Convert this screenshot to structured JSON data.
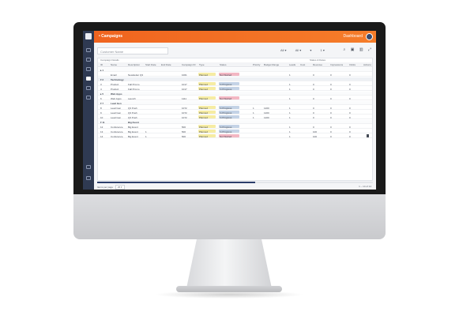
{
  "topbar": {
    "title": "• Campaigns",
    "right_label": "Dashboard"
  },
  "search": {
    "placeholder": "Customer Name"
  },
  "filters": [
    {
      "label": "All ▾"
    },
    {
      "label": "All ▾"
    },
    {
      "label": "▾"
    },
    {
      "label": "1 ▾"
    }
  ],
  "group_labels": {
    "left": "Campaign Details",
    "right": "Status & Dates"
  },
  "columns": [
    "ID",
    "Name",
    "Description",
    "Start Date",
    "End Date",
    "Campaign ID",
    "Type",
    "Status",
    "Priority",
    "Budget Range",
    "Leads",
    "Cost",
    "Revenue",
    "Impressions",
    "Clicks",
    "Actions"
  ],
  "rows": [
    {
      "kind": "group",
      "cells": [
        "▸ 1",
        "",
        "",
        "",
        "",
        "",
        "",
        "",
        "",
        "",
        "",
        "",
        "",
        "",
        "",
        ""
      ]
    },
    {
      "kind": "data",
      "cells": [
        "",
        "Email",
        "Newsletter Q3",
        "",
        "",
        "1001",
        "Planned",
        "Not Started",
        "",
        "",
        "1",
        "",
        "0",
        "0",
        "0",
        ""
      ],
      "status": "pink"
    },
    {
      "kind": "group",
      "cells": [
        "▾ 2",
        "Technology",
        "",
        "",
        "",
        "",
        "",
        "",
        "",
        "",
        "",
        "",
        "",
        "",
        "",
        ""
      ]
    },
    {
      "kind": "data",
      "cells": [
        "3",
        "Product",
        "Fall Promo",
        "",
        "",
        "1017",
        "Planned",
        "In Progress",
        "",
        "",
        "1",
        "",
        "0",
        "0",
        "0",
        ""
      ],
      "status": "blue"
    },
    {
      "kind": "data",
      "cells": [
        "4",
        "Product",
        "Fall Promo",
        "",
        "",
        "1017",
        "Planned",
        "In Progress",
        "",
        "",
        "1",
        "",
        "0",
        "0",
        "0",
        ""
      ],
      "status": "blue"
    },
    {
      "kind": "group",
      "cells": [
        "▸ 5",
        "Web Apps",
        "",
        "",
        "",
        "",
        "",
        "",
        "",
        "",
        "",
        "",
        "",
        "",
        "",
        ""
      ]
    },
    {
      "kind": "data",
      "cells": [
        "6",
        "Web Apps",
        "Launch",
        "",
        "",
        "1111",
        "Planned",
        "Not Started",
        "",
        "",
        "1",
        "",
        "0",
        "0",
        "0",
        ""
      ],
      "status": "pink"
    },
    {
      "kind": "group",
      "cells": [
        "▾ 7",
        "Lead Gen",
        "",
        "",
        "",
        "",
        "",
        "",
        "",
        "",
        "",
        "",
        "",
        "",
        "",
        ""
      ]
    },
    {
      "kind": "data",
      "cells": [
        "8",
        "Lead Gen",
        "Q3 Push",
        "",
        "",
        "1072",
        "Planned",
        "In Progress",
        "1",
        "1200",
        "1",
        "",
        "0",
        "0",
        "0",
        ""
      ],
      "status": "blue"
    },
    {
      "kind": "data",
      "cells": [
        "9",
        "Lead Gen",
        "Q3 Push",
        "",
        "",
        "1072",
        "Planned",
        "In Progress",
        "1",
        "1200",
        "1",
        "",
        "0",
        "0",
        "0",
        ""
      ],
      "status": "blue"
    },
    {
      "kind": "data",
      "cells": [
        "10",
        "Lead Gen",
        "Q3 Push",
        "",
        "",
        "1072",
        "Planned",
        "In Progress",
        "1",
        "1200",
        "1",
        "",
        "0",
        "0",
        "0",
        ""
      ],
      "status": "blue"
    },
    {
      "kind": "group",
      "cells": [
        "▾ 11",
        "",
        "Big Event",
        "",
        "",
        "",
        "",
        "",
        "",
        "",
        "",
        "",
        "",
        "",
        "",
        ""
      ]
    },
    {
      "kind": "data",
      "cells": [
        "12",
        "Conference",
        "Big Event",
        "",
        "",
        "500",
        "Planned",
        "In Progress",
        "",
        "",
        "1",
        "",
        "0",
        "0",
        "0",
        ""
      ],
      "status": "blue"
    },
    {
      "kind": "data",
      "cells": [
        "13",
        "Conference",
        "Big Event",
        "1",
        "",
        "500",
        "Planned",
        "In Progress",
        "",
        "",
        "1",
        "",
        "100",
        "0",
        "0",
        ""
      ],
      "status": "blue"
    },
    {
      "kind": "data",
      "cells": [
        "14",
        "Conference",
        "Big Event",
        "1",
        "",
        "500",
        "Planned",
        "Not Started",
        "",
        "",
        "1",
        "",
        "100",
        "0",
        "0",
        ""
      ],
      "status": "pink"
    }
  ],
  "pager": {
    "label": "Items per page",
    "page_size": "25 ▾",
    "right": "1 – 14 of 14"
  },
  "colors": {
    "accent": "#f0641f",
    "sidebar": "#2f3a52",
    "status_pink": "#f3b7c3",
    "status_blue": "#c4d3e6",
    "type_yellow": "#f6eca3"
  }
}
